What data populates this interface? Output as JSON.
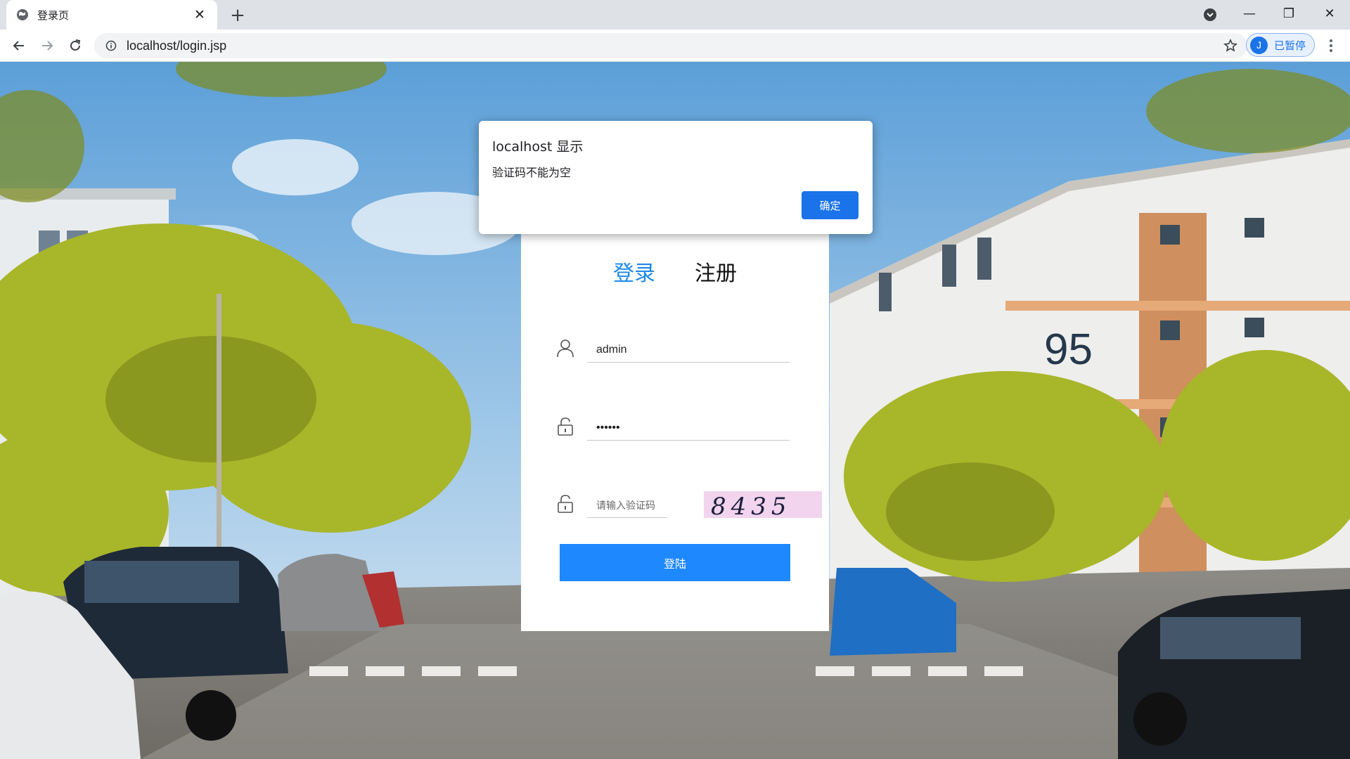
{
  "browser": {
    "tab_title": "登录页",
    "tab_close": "✕",
    "new_tab": "+",
    "url": "localhost/login.jsp",
    "profile_initial": "J",
    "profile_label": "已暂停",
    "window": {
      "minimize": "—",
      "restore": "❐",
      "close": "✕"
    }
  },
  "login": {
    "tab_login": "登录",
    "tab_register": "注册",
    "username_value": "admin",
    "password_value": "••••••",
    "captcha_placeholder": "请输入验证码",
    "captcha_code": "8435",
    "submit_label": "登陆",
    "active_tab_color": "#1e88e5",
    "button_color": "#1e88ff"
  },
  "alert": {
    "title": "localhost 显示",
    "message": "验证码不能为空",
    "ok_label": "确定"
  }
}
